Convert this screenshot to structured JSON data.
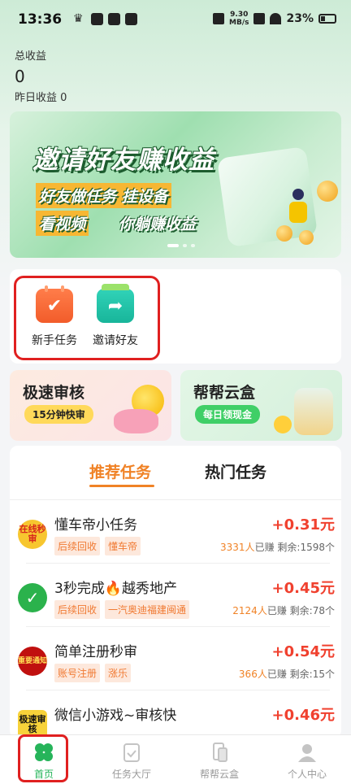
{
  "status_bar": {
    "time": "13:36",
    "net_speed": "9.30",
    "net_unit": "MB/s",
    "battery": "23%"
  },
  "earnings": {
    "total_label": "总收益",
    "total_value": "0",
    "yesterday_label": "昨日收益 0"
  },
  "banner": {
    "title": "邀请好友赚收益",
    "tag1": "好友做任务 挂设备",
    "tag2": "看视频",
    "tag3": "你躺赚收益"
  },
  "quick_entries": [
    {
      "label": "新手任务",
      "icon": "calendar-check-icon"
    },
    {
      "label": "邀请好友",
      "icon": "share-arrow-icon"
    }
  ],
  "promos": [
    {
      "title": "极速审核",
      "badge": "15分钟快审"
    },
    {
      "title": "帮帮云盒",
      "badge": "每日领现金"
    }
  ],
  "tabs": {
    "recommended": "推荐任务",
    "hot": "热门任务"
  },
  "tasks": [
    {
      "title": "懂车帝小任务",
      "icon_text": "在线秒审",
      "tags": [
        "后续回收",
        "懂车帝"
      ],
      "reward": "+0.31元",
      "earned": "3331人",
      "earned_suffix": "已赚",
      "remaining": "剩余:1598个"
    },
    {
      "title": "3秒完成🔥越秀地产",
      "icon_text": "✓",
      "tags": [
        "后续回收",
        "一汽奥迪福建闽通"
      ],
      "reward": "+0.45元",
      "earned": "2124人",
      "earned_suffix": "已赚",
      "remaining": "剩余:78个"
    },
    {
      "title": "简单注册秒审",
      "icon_text": "重要通知",
      "tags": [
        "账号注册",
        "涨乐"
      ],
      "reward": "+0.54元",
      "earned": "366人",
      "earned_suffix": "已赚",
      "remaining": "剩余:15个"
    },
    {
      "title": "微信小游戏~审核快",
      "icon_text": "极速审核",
      "tags": [],
      "reward": "+0.46元",
      "earned": "",
      "earned_suffix": "",
      "remaining": ""
    }
  ],
  "bottom_nav": [
    {
      "label": "首页",
      "icon": "home-clover-icon",
      "active": true
    },
    {
      "label": "任务大厅",
      "icon": "task-clipboard-icon",
      "active": false
    },
    {
      "label": "帮帮云盒",
      "icon": "cloud-phone-icon",
      "active": false
    },
    {
      "label": "个人中心",
      "icon": "user-profile-icon",
      "active": false
    }
  ],
  "colors": {
    "accent_orange": "#f08226",
    "reward_red": "#f0412f",
    "nav_active": "#26b45a",
    "highlight_red": "#e02020"
  }
}
